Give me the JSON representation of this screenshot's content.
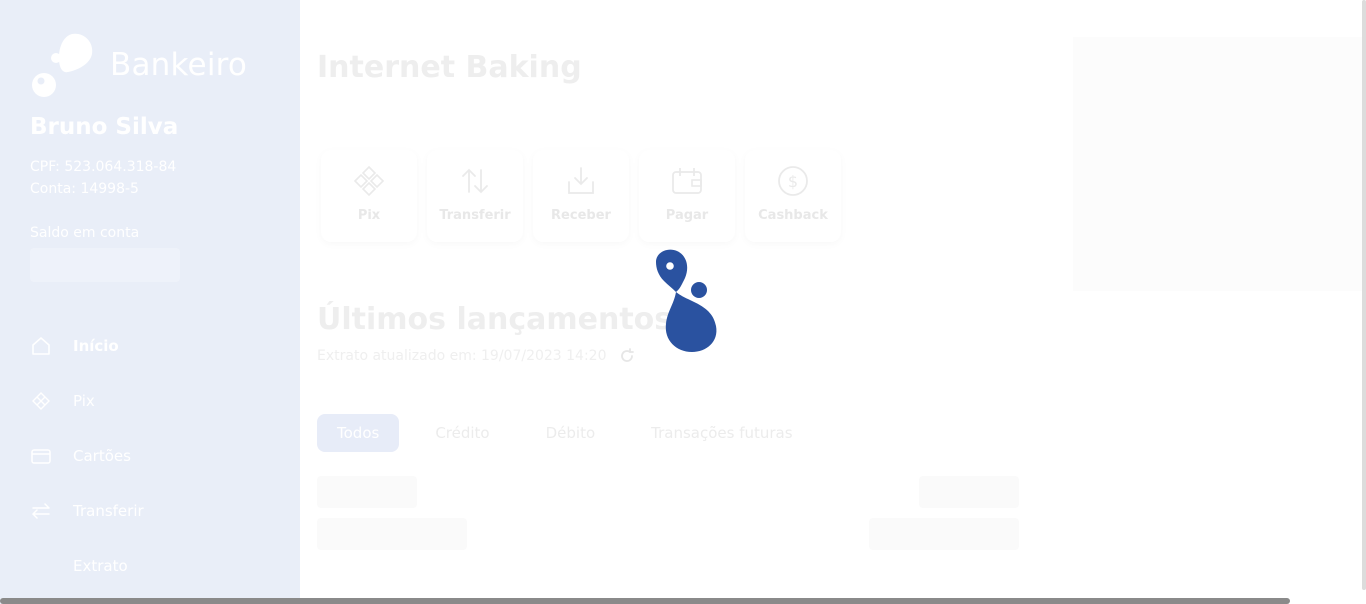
{
  "brand": {
    "name": "Bankeiro",
    "logo_icon": "bankeiro-drop-logo"
  },
  "user": {
    "name": "Bruno Silva",
    "cpf": "CPF: 523.064.318-84",
    "conta": "Conta: 14998-5",
    "saldo_label": "Saldo em conta"
  },
  "nav": {
    "items": [
      {
        "label": "Início",
        "icon": "home-icon",
        "active": true
      },
      {
        "label": "Pix",
        "icon": "pix-icon"
      },
      {
        "label": "Cartões",
        "icon": "card-icon"
      },
      {
        "label": "Transferir",
        "icon": "transfer-arrows-icon"
      },
      {
        "label": "Extrato",
        "icon": ""
      }
    ]
  },
  "main": {
    "title": "Internet Baking",
    "actions": [
      {
        "label": "Pix",
        "icon": "pix-icon"
      },
      {
        "label": "Transferir",
        "icon": "transfer-icon"
      },
      {
        "label": "Receber",
        "icon": "receive-icon"
      },
      {
        "label": "Pagar",
        "icon": "wallet-icon"
      },
      {
        "label": "Cashback",
        "icon": "dollar-circle-icon"
      }
    ],
    "statement_title": "Últimos lançamentos",
    "updated_text": "Extrato atualizado em: 19/07/2023 14:20",
    "filters": [
      {
        "label": "Todos",
        "active": true
      },
      {
        "label": "Crédito"
      },
      {
        "label": "Débito"
      },
      {
        "label": "Transações futuras"
      }
    ]
  },
  "loading": {
    "icon": "bankeiro-loading-logo",
    "color": "#2a52a0"
  },
  "colors": {
    "sidebar_bg": "#e9eef8",
    "brand_blue": "#2a52a0"
  }
}
